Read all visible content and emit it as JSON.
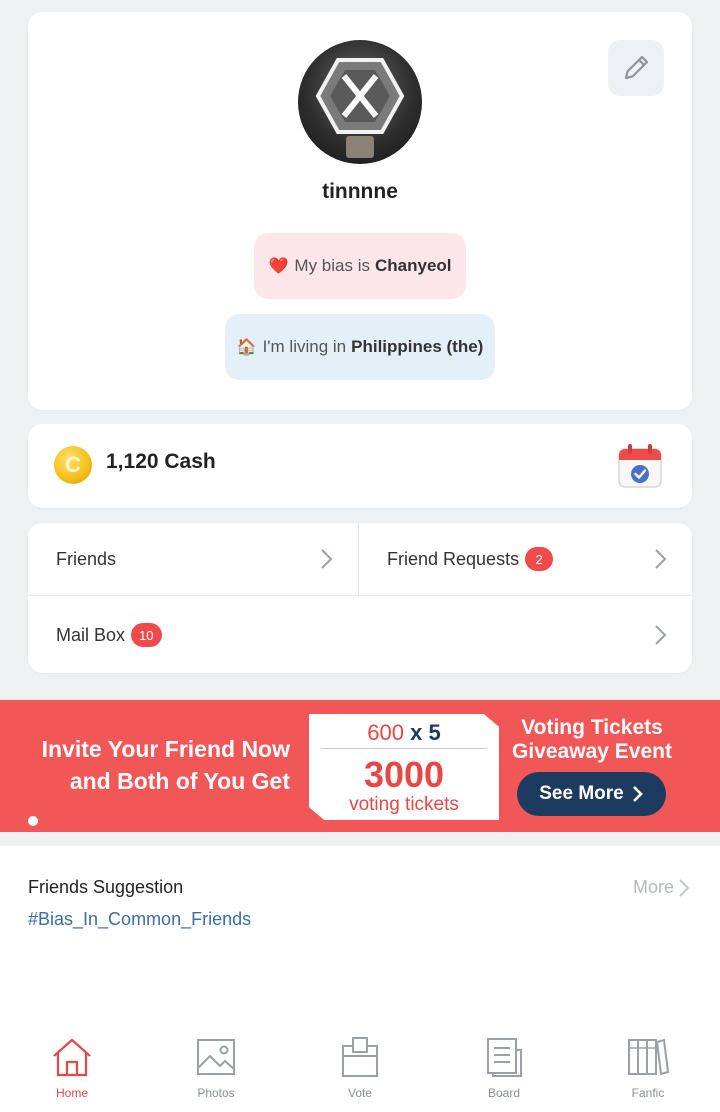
{
  "profile": {
    "username": "tinnnne",
    "bias_emoji": "❤️",
    "bias_prefix": "My bias is",
    "bias_value": "Chanyeol",
    "living_emoji": "🏠",
    "living_prefix": "I'm living in",
    "living_value": "Philippines (the)",
    "edit_icon": "pencil-icon"
  },
  "cash": {
    "label": "1,120 Cash",
    "coin_letter": "C",
    "calendar_icon": "calendar-check-icon"
  },
  "menu": {
    "friends": "Friends",
    "friend_requests": "Friend Requests",
    "friend_requests_badge": "2",
    "mail_box": "Mail Box",
    "mail_box_badge": "10"
  },
  "banner": {
    "line1": "Invite Your Friend Now",
    "line2": "and Both of You Get",
    "ticket_amount": "600",
    "ticket_multiplier": "x 5",
    "ticket_total": "3000",
    "ticket_unit": "voting tickets",
    "event_title_1": "Voting Tickets",
    "event_title_2": "Giveaway Event",
    "button": "See More"
  },
  "suggestions": {
    "title": "Friends Suggestion",
    "hashtag": "#Bias_In_Common_Friends",
    "more": "More"
  },
  "tabs": [
    {
      "label": "Home",
      "icon": "home-icon",
      "active": true
    },
    {
      "label": "Photos",
      "icon": "photos-icon",
      "active": false
    },
    {
      "label": "Vote",
      "icon": "vote-icon",
      "active": false
    },
    {
      "label": "Board",
      "icon": "board-icon",
      "active": false
    },
    {
      "label": "Fanfic",
      "icon": "fanfic-icon",
      "active": false
    }
  ],
  "colors": {
    "accent_red": "#f25757",
    "navy": "#1d3b5e",
    "hashtag_blue": "#3b6ea5"
  }
}
